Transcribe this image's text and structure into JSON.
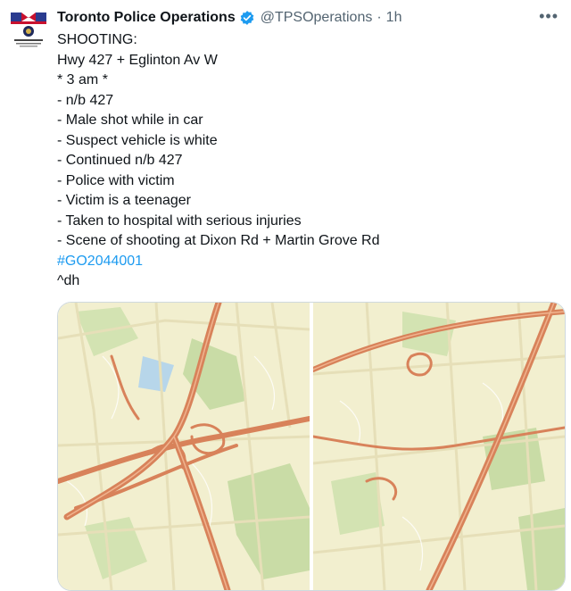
{
  "tweet": {
    "author_name": "Toronto Police Operations",
    "handle": "@TPSOperations",
    "separator": "·",
    "time": "1h",
    "more_icon": "more-horizontal-icon",
    "verified_icon": "verified-badge-icon",
    "lines": [
      "SHOOTING:",
      "Hwy 427 + Eglinton Av W",
      "* 3 am *",
      "- n/b 427",
      "- Male shot while in car",
      "- Suspect vehicle is white",
      "- Continued n/b 427",
      "- Police with victim",
      "- Victim is a teenager",
      "- Taken to hospital with serious injuries",
      "- Scene of shooting at Dixon Rd + Martin Grove Rd"
    ],
    "hashtag": "#GO2044001",
    "signature": "^dh"
  },
  "colors": {
    "link": "#1d9bf0",
    "map_land": "#f2efcf",
    "map_park": "#c9dca6",
    "map_highway": "#d8825a"
  }
}
